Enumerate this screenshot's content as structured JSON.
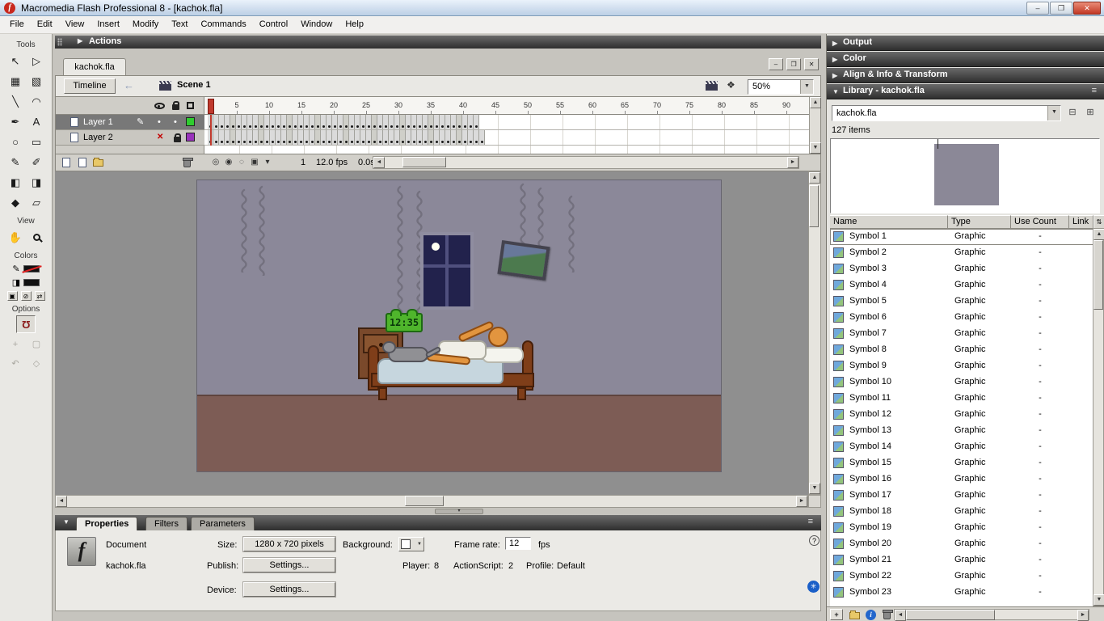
{
  "window": {
    "title": "Macromedia Flash Professional 8 - [kachok.fla]",
    "controls": {
      "minimize": "–",
      "restore": "❐",
      "close": "✕"
    }
  },
  "menu": {
    "items": [
      "File",
      "Edit",
      "View",
      "Insert",
      "Modify",
      "Text",
      "Commands",
      "Control",
      "Window",
      "Help"
    ]
  },
  "actions_panel": {
    "title": "Actions"
  },
  "tools_panel": {
    "labels": {
      "tools": "Tools",
      "view": "View",
      "colors": "Colors",
      "options": "Options"
    },
    "tools": [
      {
        "id": "selection-tool",
        "glyph": "↖"
      },
      {
        "id": "subselection-tool",
        "glyph": "▷"
      },
      {
        "id": "free-transform-tool",
        "glyph": "▦"
      },
      {
        "id": "gradient-transform-tool",
        "glyph": "▧"
      },
      {
        "id": "line-tool",
        "glyph": "╲"
      },
      {
        "id": "lasso-tool",
        "glyph": "◠"
      },
      {
        "id": "pen-tool",
        "glyph": "✒"
      },
      {
        "id": "text-tool",
        "glyph": "A"
      },
      {
        "id": "oval-tool",
        "glyph": "○"
      },
      {
        "id": "rectangle-tool",
        "glyph": "▭"
      },
      {
        "id": "pencil-tool",
        "glyph": "✎"
      },
      {
        "id": "brush-tool",
        "glyph": "✐"
      },
      {
        "id": "ink-bottle-tool",
        "glyph": "◧"
      },
      {
        "id": "paint-bucket-tool",
        "glyph": "◨"
      },
      {
        "id": "eyedropper-tool",
        "glyph": "◆"
      },
      {
        "id": "eraser-tool",
        "glyph": "▱"
      }
    ],
    "view_tools": [
      {
        "id": "hand-tool",
        "glyph": "✋"
      },
      {
        "id": "zoom-tool",
        "glyph": ""
      }
    ],
    "colors_icons": {
      "stroke_glyph": "✎",
      "fill_glyph": "◨",
      "default_glyph": "▣",
      "none_glyph": "⊘",
      "swap_glyph": "⇄"
    },
    "options_icons": {
      "magnet_glyph": "Ω",
      "extra_glyphs": [
        "+",
        "▢",
        "↶",
        "◇"
      ]
    }
  },
  "document_tab": {
    "label": "kachok.fla"
  },
  "edit_bar": {
    "timeline_button": "Timeline",
    "scene_name": "Scene 1",
    "zoom_value": "50%"
  },
  "timeline": {
    "layers": [
      {
        "name": "Layer 1",
        "swatch": "#2FCC2F",
        "keyframes": 48
      },
      {
        "name": "Layer 2",
        "swatch": "#9933BB",
        "keyframes": 49
      }
    ],
    "ruler_numbers": [
      5,
      10,
      15,
      20,
      25,
      30,
      35,
      40,
      45,
      50,
      55,
      60,
      65,
      70,
      75,
      80,
      85,
      90
    ],
    "onion_icons": [
      "◎",
      "◉",
      "◌",
      "▣",
      "▾"
    ],
    "edit_pencil_glyph": "✎",
    "current_frame": "1",
    "frame_rate": "12.0 fps",
    "elapsed_time": "0.0s"
  },
  "stage": {
    "clock_time": "12:35"
  },
  "properties": {
    "tabs": [
      "Properties",
      "Filters",
      "Parameters"
    ],
    "document_label": "Document",
    "document_name": "kachok.fla",
    "size_label": "Size:",
    "size_value": "1280 x 720 pixels",
    "background_label": "Background:",
    "frame_rate_label": "Frame rate:",
    "frame_rate_value": "12",
    "fps_suffix": "fps",
    "publish_label": "Publish:",
    "publish_button": "Settings...",
    "player_label": "Player:",
    "player_value": "8",
    "actionscript_label": "ActionScript:",
    "actionscript_value": "2",
    "profile_label": "Profile:",
    "profile_value": "Default",
    "device_label": "Device:",
    "device_button": "Settings...",
    "help_icon": "?",
    "update_icon": "✳"
  },
  "right_panels": {
    "output": "Output",
    "color": "Color",
    "align": "Align & Info & Transform"
  },
  "library": {
    "panel_title": "Library - kachok.fla",
    "dropdown_value": "kachok.fla",
    "item_count": "127 items",
    "columns": [
      "Name",
      "Type",
      "Use Count",
      "Link"
    ],
    "items": [
      {
        "name": "Symbol 1",
        "type": "Graphic",
        "use_count": "-"
      },
      {
        "name": "Symbol 2",
        "type": "Graphic",
        "use_count": "-"
      },
      {
        "name": "Symbol 3",
        "type": "Graphic",
        "use_count": "-"
      },
      {
        "name": "Symbol 4",
        "type": "Graphic",
        "use_count": "-"
      },
      {
        "name": "Symbol 5",
        "type": "Graphic",
        "use_count": "-"
      },
      {
        "name": "Symbol 6",
        "type": "Graphic",
        "use_count": "-"
      },
      {
        "name": "Symbol 7",
        "type": "Graphic",
        "use_count": "-"
      },
      {
        "name": "Symbol 8",
        "type": "Graphic",
        "use_count": "-"
      },
      {
        "name": "Symbol 9",
        "type": "Graphic",
        "use_count": "-"
      },
      {
        "name": "Symbol 10",
        "type": "Graphic",
        "use_count": "-"
      },
      {
        "name": "Symbol 11",
        "type": "Graphic",
        "use_count": "-"
      },
      {
        "name": "Symbol 12",
        "type": "Graphic",
        "use_count": "-"
      },
      {
        "name": "Symbol 13",
        "type": "Graphic",
        "use_count": "-"
      },
      {
        "name": "Symbol 14",
        "type": "Graphic",
        "use_count": "-"
      },
      {
        "name": "Symbol 15",
        "type": "Graphic",
        "use_count": "-"
      },
      {
        "name": "Symbol 16",
        "type": "Graphic",
        "use_count": "-"
      },
      {
        "name": "Symbol 17",
        "type": "Graphic",
        "use_count": "-"
      },
      {
        "name": "Symbol 18",
        "type": "Graphic",
        "use_count": "-"
      },
      {
        "name": "Symbol 19",
        "type": "Graphic",
        "use_count": "-"
      },
      {
        "name": "Symbol 20",
        "type": "Graphic",
        "use_count": "-"
      },
      {
        "name": "Symbol 21",
        "type": "Graphic",
        "use_count": "-"
      },
      {
        "name": "Symbol 22",
        "type": "Graphic",
        "use_count": "-"
      },
      {
        "name": "Symbol 23",
        "type": "Graphic",
        "use_count": "-"
      }
    ]
  }
}
